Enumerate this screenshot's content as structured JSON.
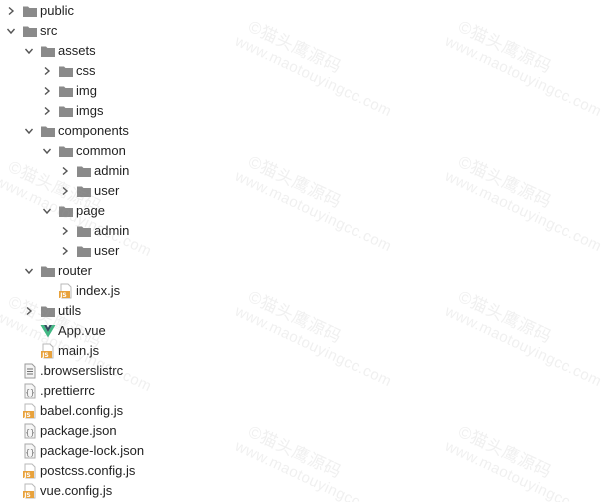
{
  "watermark": {
    "line1": "©猫头鹰源码",
    "line2": "www.maotouyingcc.com"
  },
  "tree": [
    {
      "label": "public",
      "depth": 0,
      "type": "folder",
      "chevron": "right"
    },
    {
      "label": "src",
      "depth": 0,
      "type": "folder",
      "chevron": "down"
    },
    {
      "label": "assets",
      "depth": 1,
      "type": "folder",
      "chevron": "down"
    },
    {
      "label": "css",
      "depth": 2,
      "type": "folder",
      "chevron": "right"
    },
    {
      "label": "img",
      "depth": 2,
      "type": "folder",
      "chevron": "right"
    },
    {
      "label": "imgs",
      "depth": 2,
      "type": "folder",
      "chevron": "right"
    },
    {
      "label": "components",
      "depth": 1,
      "type": "folder",
      "chevron": "down"
    },
    {
      "label": "common",
      "depth": 2,
      "type": "folder",
      "chevron": "down"
    },
    {
      "label": "admin",
      "depth": 3,
      "type": "folder",
      "chevron": "right"
    },
    {
      "label": "user",
      "depth": 3,
      "type": "folder",
      "chevron": "right"
    },
    {
      "label": "page",
      "depth": 2,
      "type": "folder",
      "chevron": "down"
    },
    {
      "label": "admin",
      "depth": 3,
      "type": "folder",
      "chevron": "right"
    },
    {
      "label": "user",
      "depth": 3,
      "type": "folder",
      "chevron": "right"
    },
    {
      "label": "router",
      "depth": 1,
      "type": "folder",
      "chevron": "down"
    },
    {
      "label": "index.js",
      "depth": 2,
      "type": "js",
      "chevron": "none"
    },
    {
      "label": "utils",
      "depth": 1,
      "type": "folder",
      "chevron": "right"
    },
    {
      "label": "App.vue",
      "depth": 1,
      "type": "vue",
      "chevron": "none"
    },
    {
      "label": "main.js",
      "depth": 1,
      "type": "js",
      "chevron": "none"
    },
    {
      "label": ".browserslistrc",
      "depth": 0,
      "type": "text",
      "chevron": "none"
    },
    {
      "label": ".prettierrc",
      "depth": 0,
      "type": "config",
      "chevron": "none"
    },
    {
      "label": "babel.config.js",
      "depth": 0,
      "type": "js",
      "chevron": "none"
    },
    {
      "label": "package.json",
      "depth": 0,
      "type": "config",
      "chevron": "none"
    },
    {
      "label": "package-lock.json",
      "depth": 0,
      "type": "config",
      "chevron": "none"
    },
    {
      "label": "postcss.config.js",
      "depth": 0,
      "type": "js",
      "chevron": "none"
    },
    {
      "label": "vue.config.js",
      "depth": 0,
      "type": "js",
      "chevron": "none"
    }
  ],
  "colors": {
    "folder": "#8a8a8a",
    "chevron": "#555555",
    "js_badge": "#e8a23c",
    "vue_green": "#41b883",
    "vue_dark": "#34495e",
    "text": "#222222"
  }
}
